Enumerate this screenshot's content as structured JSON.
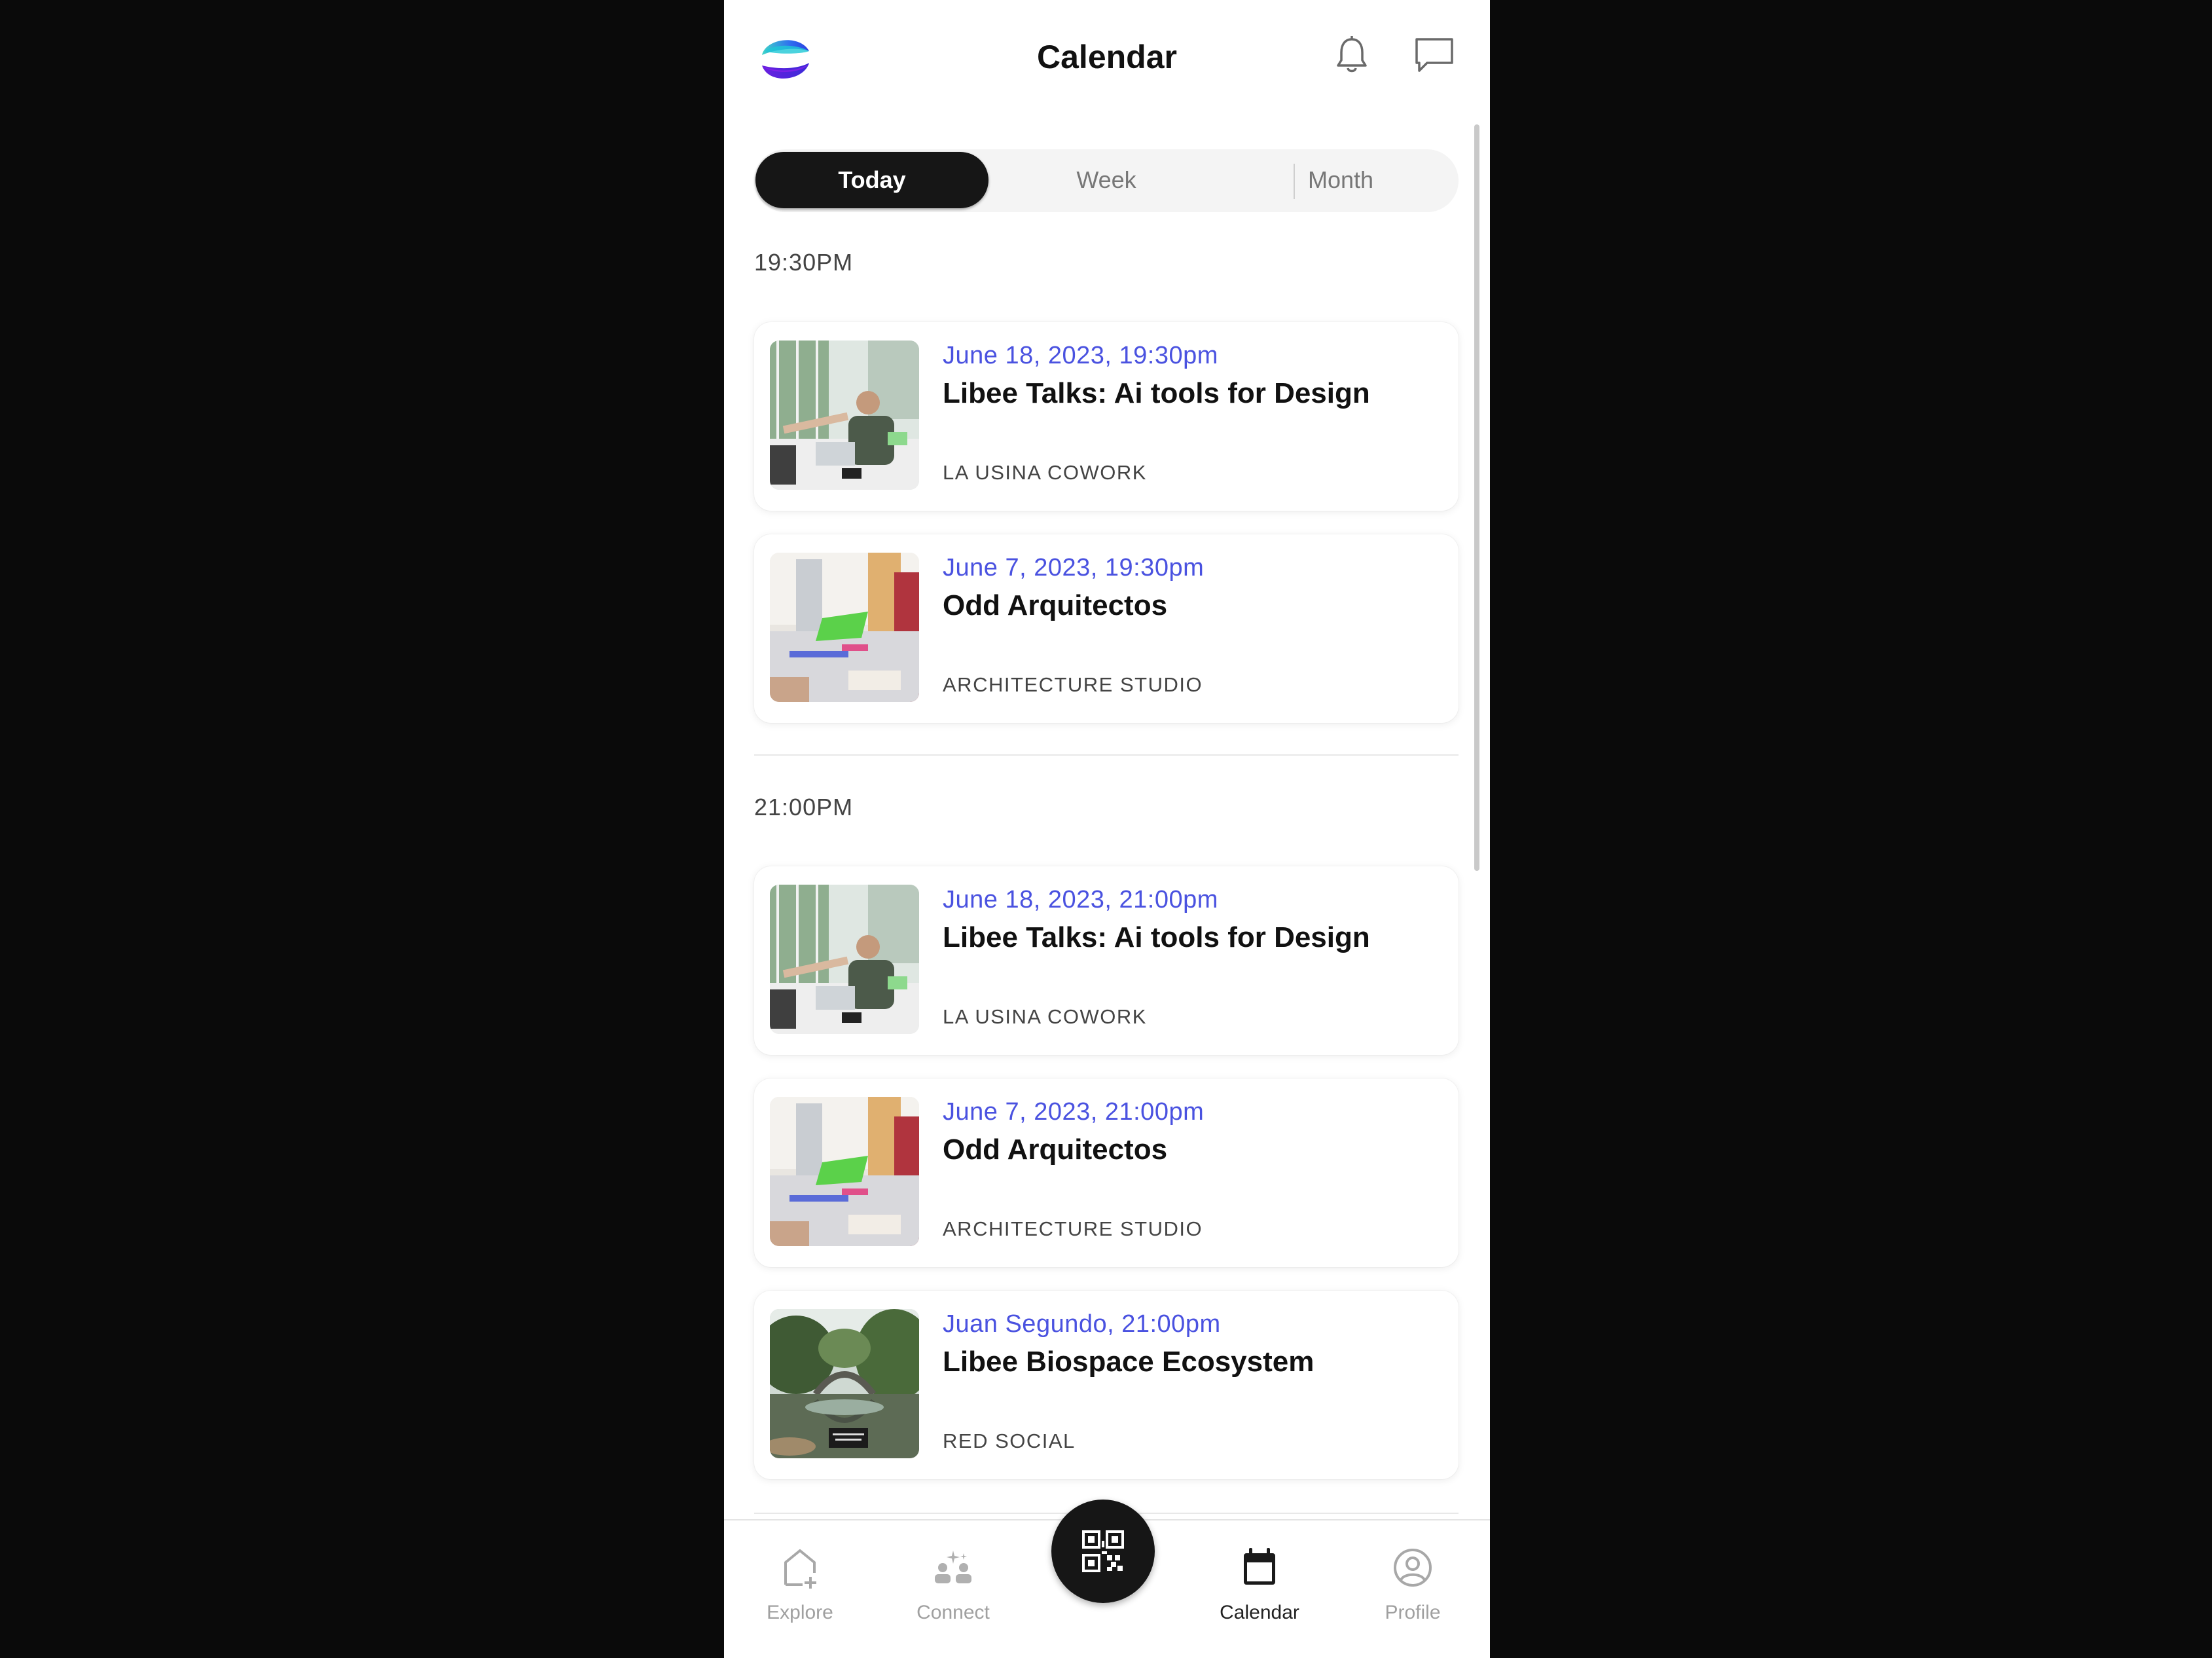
{
  "header": {
    "title": "Calendar",
    "logo_icon": "app-logo-icon",
    "notifications_icon": "bell-icon",
    "messages_icon": "chat-icon"
  },
  "tabs": [
    {
      "label": "Today",
      "selected": true
    },
    {
      "label": "Week",
      "selected": false
    },
    {
      "label": "Month",
      "selected": false
    }
  ],
  "sections": [
    {
      "time": "19:30PM",
      "events": [
        {
          "date": "June 18, 2023, 19:30pm",
          "title": "Libee Talks: Ai tools for Design",
          "venue": "LA USINA COWORK",
          "image": "office-meeting"
        },
        {
          "date": "June 7, 2023, 19:30pm",
          "title": "Odd Arquitectos",
          "venue": "ARCHITECTURE STUDIO",
          "image": "architects-table"
        }
      ]
    },
    {
      "time": "21:00PM",
      "events": [
        {
          "date": "June 18, 2023, 21:00pm",
          "title": "Libee Talks: Ai tools for Design",
          "venue": "LA USINA COWORK",
          "image": "office-meeting"
        },
        {
          "date": "June 7, 2023, 21:00pm",
          "title": "Odd Arquitectos",
          "venue": "ARCHITECTURE STUDIO",
          "image": "architects-table"
        },
        {
          "date": "Juan Segundo, 21:00pm",
          "title": "Libee Biospace Ecosystem",
          "venue": "RED SOCIAL",
          "image": "forest-bridge"
        }
      ]
    }
  ],
  "nav": [
    {
      "label": "Explore",
      "icon": "explore-icon",
      "active": false
    },
    {
      "label": "Connect",
      "icon": "connect-icon",
      "active": false
    },
    {
      "label": "Calendar",
      "icon": "calendar-icon",
      "active": true
    },
    {
      "label": "Profile",
      "icon": "profile-icon",
      "active": false
    }
  ],
  "qr_icon": "qr-code-icon",
  "colors": {
    "accent": "#4a52e0",
    "dark": "#161616",
    "background": "#0a0a0a"
  }
}
